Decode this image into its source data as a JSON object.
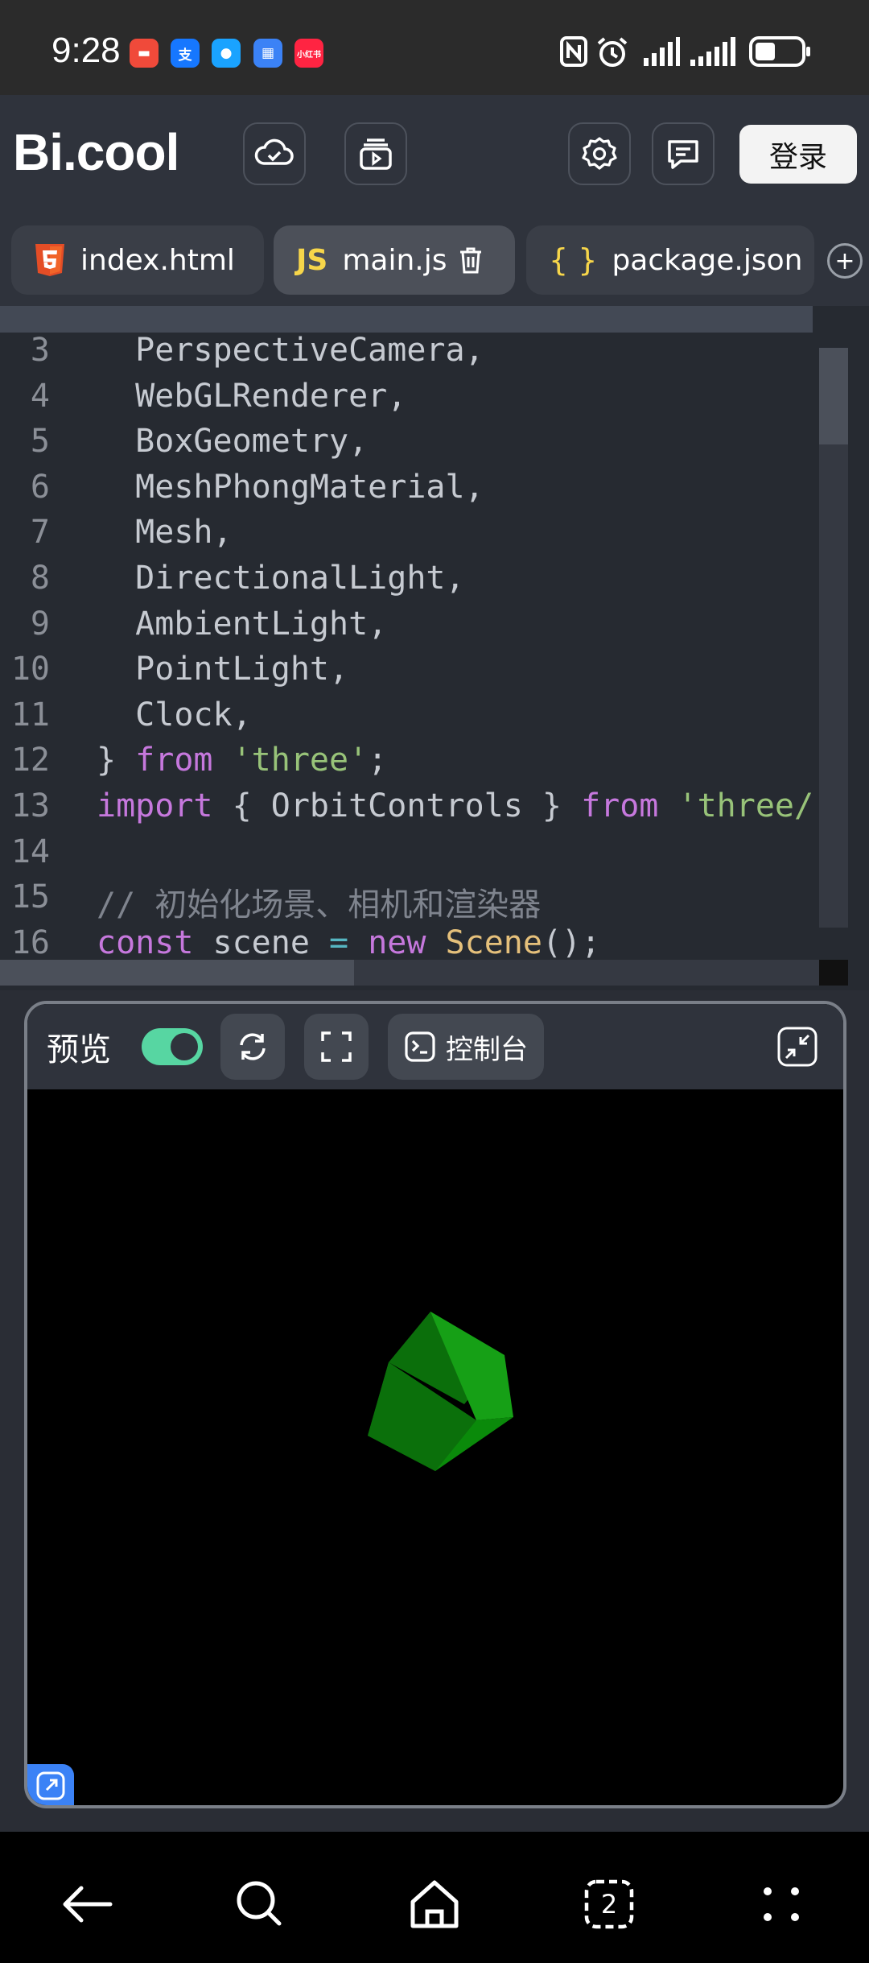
{
  "status_bar": {
    "time": "9:28",
    "app_icons": [
      {
        "name": "app-icon-wallet",
        "color": "#f04a3a",
        "glyph": "▬"
      },
      {
        "name": "app-icon-alipay",
        "color": "#1677ff",
        "glyph": "支"
      },
      {
        "name": "app-icon-chat",
        "color": "#1aa3ff",
        "glyph": "●"
      },
      {
        "name": "app-icon-calendar",
        "color": "#3b82f6",
        "glyph": "▦"
      },
      {
        "name": "app-icon-xiaohongshu",
        "color": "#ff2442",
        "glyph": "小红书"
      }
    ],
    "indicators": [
      "nfc-icon",
      "alarm-icon",
      "signal-icon",
      "signal-icon",
      "battery-icon"
    ]
  },
  "header": {
    "logo": "Bi.cool",
    "buttons": [
      "cloud-icon",
      "play-box-icon",
      "gear-icon",
      "message-icon"
    ],
    "login_label": "登录"
  },
  "tabs": [
    {
      "label": "index.html",
      "icon": "html5-icon",
      "active": false
    },
    {
      "label": "main.js",
      "icon": "js-icon",
      "badge": "JS",
      "active": true
    },
    {
      "label": "package.json",
      "icon": "json-icon",
      "badge": "{ }",
      "active": false
    }
  ],
  "editor": {
    "lines": [
      {
        "n": "3",
        "tokens": [
          {
            "t": "  PerspectiveCamera,",
            "c": ""
          }
        ]
      },
      {
        "n": "4",
        "tokens": [
          {
            "t": "  WebGLRenderer,",
            "c": ""
          }
        ]
      },
      {
        "n": "5",
        "tokens": [
          {
            "t": "  BoxGeometry,",
            "c": ""
          }
        ]
      },
      {
        "n": "6",
        "tokens": [
          {
            "t": "  MeshPhongMaterial,",
            "c": ""
          }
        ]
      },
      {
        "n": "7",
        "tokens": [
          {
            "t": "  Mesh,",
            "c": ""
          }
        ]
      },
      {
        "n": "8",
        "tokens": [
          {
            "t": "  DirectionalLight,",
            "c": ""
          }
        ]
      },
      {
        "n": "9",
        "tokens": [
          {
            "t": "  AmbientLight,",
            "c": ""
          }
        ]
      },
      {
        "n": "10",
        "tokens": [
          {
            "t": "  PointLight,",
            "c": ""
          }
        ]
      },
      {
        "n": "11",
        "tokens": [
          {
            "t": "  Clock,",
            "c": ""
          }
        ]
      },
      {
        "n": "12",
        "tokens": [
          {
            "t": "} ",
            "c": ""
          },
          {
            "t": "from",
            "c": "kw"
          },
          {
            "t": " ",
            "c": ""
          },
          {
            "t": "'three'",
            "c": "str"
          },
          {
            "t": ";",
            "c": ""
          }
        ]
      },
      {
        "n": "13",
        "tokens": [
          {
            "t": "import",
            "c": "kw"
          },
          {
            "t": " { OrbitControls } ",
            "c": ""
          },
          {
            "t": "from",
            "c": "kw"
          },
          {
            "t": " ",
            "c": ""
          },
          {
            "t": "'three/",
            "c": "str"
          }
        ]
      },
      {
        "n": "14",
        "tokens": []
      },
      {
        "n": "15",
        "tokens": [
          {
            "t": "// 初始化场景、相机和渲染器",
            "c": "cm"
          }
        ]
      },
      {
        "n": "16",
        "tokens": [
          {
            "t": "const",
            "c": "kw"
          },
          {
            "t": " scene ",
            "c": ""
          },
          {
            "t": "=",
            "c": "op"
          },
          {
            "t": " ",
            "c": ""
          },
          {
            "t": "new",
            "c": "kw"
          },
          {
            "t": " ",
            "c": ""
          },
          {
            "t": "Scene",
            "c": "cls"
          },
          {
            "t": "();",
            "c": ""
          }
        ]
      }
    ]
  },
  "preview": {
    "label": "预览",
    "toggle_on": true,
    "console_label": "控制台",
    "scene_object": "green cube",
    "cube_colors": [
      "#0a8a0a",
      "#16a016",
      "#0b6f0b"
    ]
  },
  "navbar": {
    "buttons": [
      "back-icon",
      "search-icon",
      "home-icon",
      "tabs-icon",
      "more-icon"
    ],
    "tabs_count": "2"
  }
}
